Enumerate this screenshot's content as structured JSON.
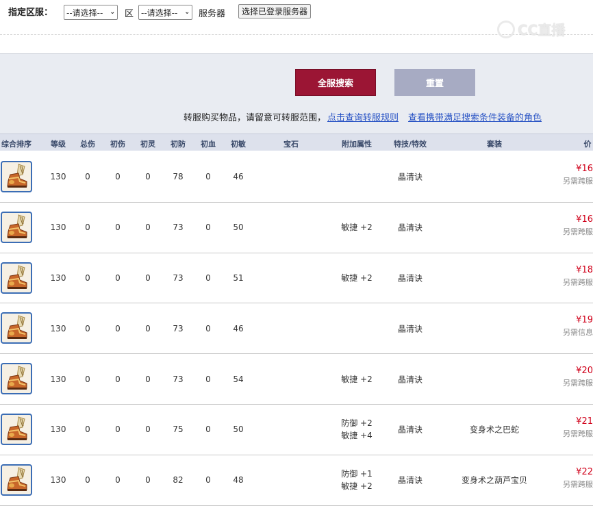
{
  "filter": {
    "label": "指定区服：",
    "select1": "--请选择--",
    "zone_label": "区",
    "select2": "--请选择--",
    "server_label": "服务器",
    "login_server_btn": "选择已登录服务器"
  },
  "watermark": "CC直播",
  "search": {
    "search_btn": "全服搜索",
    "reset_btn": "重置",
    "notice_text": "转服购买物品，请留意可转服范围，",
    "rule_link": "点击查询转服规则",
    "role_link": "查看携带满足搜索条件装备的角色"
  },
  "table": {
    "headers": [
      "综合排序",
      "等级",
      "总伤",
      "初伤",
      "初灵",
      "初防",
      "初血",
      "初敏",
      "宝石",
      "附加属性",
      "特技/特效",
      "套装",
      "价"
    ],
    "rows": [
      {
        "level": "130",
        "total": "0",
        "dmg": "0",
        "spirit": "0",
        "def": "78",
        "hp": "0",
        "agi": "46",
        "attrs": [],
        "skill": "晶清诀",
        "set": "",
        "price": "¥16",
        "note": "另需跨服"
      },
      {
        "level": "130",
        "total": "0",
        "dmg": "0",
        "spirit": "0",
        "def": "73",
        "hp": "0",
        "agi": "50",
        "attrs": [
          "敏捷 +2"
        ],
        "skill": "晶清诀",
        "set": "",
        "price": "¥16",
        "note": "另需跨服"
      },
      {
        "level": "130",
        "total": "0",
        "dmg": "0",
        "spirit": "0",
        "def": "73",
        "hp": "0",
        "agi": "51",
        "attrs": [
          "敏捷 +2"
        ],
        "skill": "晶清诀",
        "set": "",
        "price": "¥18",
        "note": "另需跨服"
      },
      {
        "level": "130",
        "total": "0",
        "dmg": "0",
        "spirit": "0",
        "def": "73",
        "hp": "0",
        "agi": "46",
        "attrs": [],
        "skill": "晶清诀",
        "set": "",
        "price": "¥19",
        "note": "另需信息"
      },
      {
        "level": "130",
        "total": "0",
        "dmg": "0",
        "spirit": "0",
        "def": "73",
        "hp": "0",
        "agi": "54",
        "attrs": [
          "敏捷 +2"
        ],
        "skill": "晶清诀",
        "set": "",
        "price": "¥20",
        "note": "另需跨服"
      },
      {
        "level": "130",
        "total": "0",
        "dmg": "0",
        "spirit": "0",
        "def": "75",
        "hp": "0",
        "agi": "50",
        "attrs": [
          "防御 +2",
          "敏捷 +4"
        ],
        "skill": "晶清诀",
        "set": "变身术之巴蛇",
        "price": "¥21",
        "note": "另需跨服"
      },
      {
        "level": "130",
        "total": "0",
        "dmg": "0",
        "spirit": "0",
        "def": "82",
        "hp": "0",
        "agi": "48",
        "attrs": [
          "防御 +1",
          "敏捷 +2"
        ],
        "skill": "晶清诀",
        "set": "变身术之葫芦宝贝",
        "price": "¥22",
        "note": "另需跨服"
      }
    ]
  },
  "colors": {
    "search_btn": "#9b1534",
    "reset_btn": "#a7abc3",
    "price": "#d0021b",
    "link": "#2b55c5"
  },
  "icons": {
    "item": "boots-equipment-icon",
    "dropdown": "chevron-down-icon"
  }
}
